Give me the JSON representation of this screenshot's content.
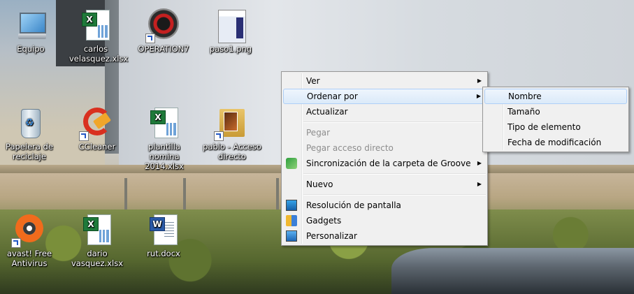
{
  "desktop": {
    "icons": [
      {
        "label": "Equipo"
      },
      {
        "label": "carlos velasquez.xlsx"
      },
      {
        "label": "OPERATION7"
      },
      {
        "label": "paso1.png"
      },
      {
        "label": "Papelera de reciclaje"
      },
      {
        "label": "CCleaner"
      },
      {
        "label": "plantilla  nomina 2014.xlsx"
      },
      {
        "label": "pablo - Acceso directo"
      },
      {
        "label": "avast! Free Antivirus"
      },
      {
        "label": "dario vasquez.xlsx"
      },
      {
        "label": "rut.docx"
      }
    ]
  },
  "context_menu": {
    "items": [
      {
        "label": "Ver"
      },
      {
        "label": "Ordenar por"
      },
      {
        "label": "Actualizar"
      },
      {
        "label": "Pegar"
      },
      {
        "label": "Pegar acceso directo"
      },
      {
        "label": "Sincronización de la carpeta de Groove"
      },
      {
        "label": "Nuevo"
      },
      {
        "label": "Resolución de pantalla"
      },
      {
        "label": "Gadgets"
      },
      {
        "label": "Personalizar"
      }
    ],
    "highlighted": "Ordenar por"
  },
  "submenu": {
    "items": [
      {
        "label": "Nombre"
      },
      {
        "label": "Tamaño"
      },
      {
        "label": "Tipo de elemento"
      },
      {
        "label": "Fecha de modificación"
      }
    ],
    "highlighted": "Nombre"
  },
  "colors": {
    "menu_bg": "#f0f0f0",
    "menu_border": "#979797",
    "highlight_border": "#aecff7",
    "disabled_text": "#8d8d8d"
  }
}
